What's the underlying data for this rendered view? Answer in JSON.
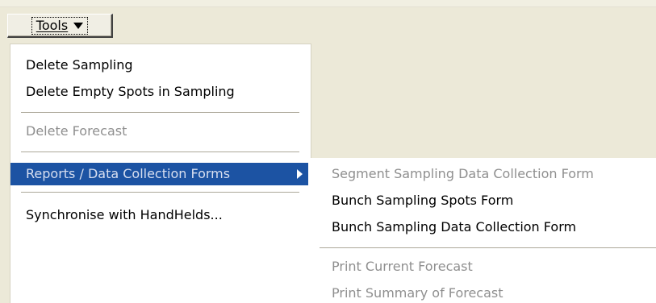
{
  "toolbar": {
    "tools_label": "Tools"
  },
  "menu": {
    "items": [
      {
        "label": "Delete Sampling"
      },
      {
        "label": "Delete Empty Spots in Sampling"
      },
      {
        "label": "Delete Forecast"
      },
      {
        "label": "Reports / Data Collection Forms"
      },
      {
        "label": "Synchronise with HandHelds..."
      }
    ]
  },
  "submenu": {
    "items": [
      {
        "label": "Segment Sampling Data Collection Form"
      },
      {
        "label": "Bunch Sampling Spots Form"
      },
      {
        "label": "Bunch Sampling Data Collection Form"
      },
      {
        "label": "Print Current Forecast"
      },
      {
        "label": "Print Summary of Forecast"
      }
    ]
  },
  "colors": {
    "menu_background": "#ffffff",
    "window_background": "#ece9d8",
    "selection_background": "#1c53a3",
    "disabled_text": "#8f8f8f"
  },
  "icons": {
    "dropdown": "triangle-down-icon",
    "submenu": "triangle-right-icon"
  }
}
